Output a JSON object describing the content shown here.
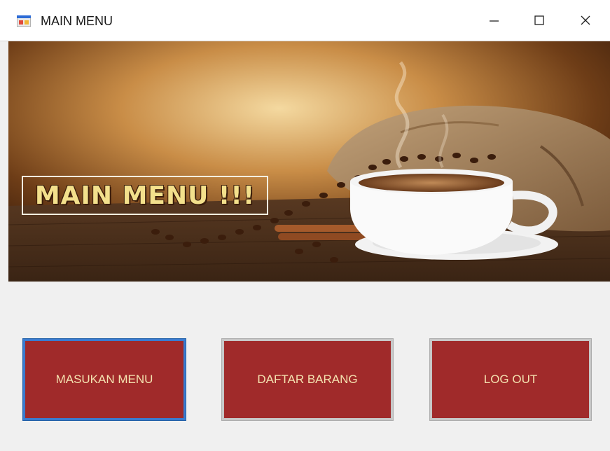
{
  "window": {
    "title": "MAIN MENU",
    "controls": [
      "minimize",
      "maximize",
      "close"
    ]
  },
  "banner": {
    "heading": "MAIN MENU !!!"
  },
  "buttons": [
    {
      "label": "MASUKAN MENU",
      "focused": true
    },
    {
      "label": "DAFTAR BARANG",
      "focused": false
    },
    {
      "label": "LOG OUT",
      "focused": false
    }
  ],
  "colors": {
    "button_bg": "#a02a2a",
    "button_text": "#f4e2b0",
    "focus_border": "#3a7bcf",
    "banner_heading": "#f3e08c",
    "window_bg": "#f0f0f0"
  }
}
